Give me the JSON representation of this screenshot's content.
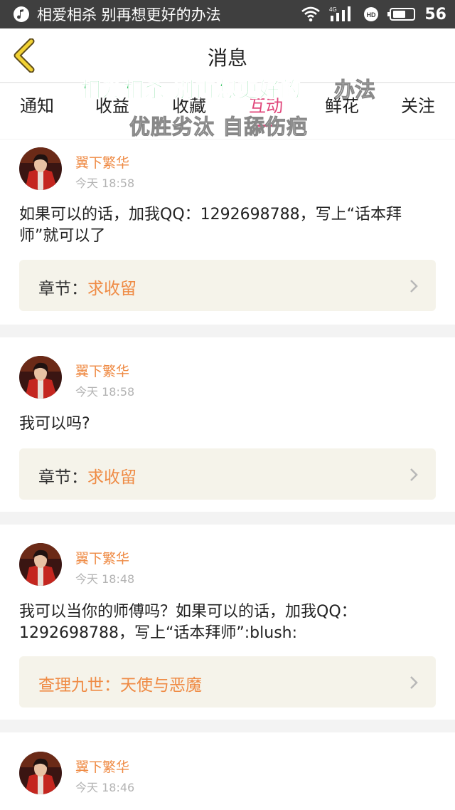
{
  "status_bar": {
    "app_icon": "music-note-icon",
    "title": "相爱相杀 别再想更好的办法",
    "time": "56",
    "icons": [
      "wifi-icon",
      "signal-4g-icon",
      "hd-icon",
      "battery-icon"
    ],
    "network_label": "4G",
    "hd_label": "HD"
  },
  "nav": {
    "back_icon": "back-arrow-icon",
    "title": "消息"
  },
  "tabs": [
    {
      "label": "通知",
      "active": false
    },
    {
      "label": "收益",
      "active": false
    },
    {
      "label": "收藏",
      "active": false
    },
    {
      "label": "互动",
      "active": true
    },
    {
      "label": "鲜花",
      "active": false
    },
    {
      "label": "关注",
      "active": false
    }
  ],
  "lyrics": {
    "line1_sung": "相爱相杀 别再想更好的",
    "line1_unsung": "办法",
    "line2": "优胜劣汰 自舔伤疤"
  },
  "messages": [
    {
      "username": "翼下繁华",
      "time": "今天 18:58",
      "content": "如果可以的话，加我QQ：1292698788，写上“话本拜师”就可以了",
      "chapter_label": "章节：",
      "chapter_value": "求收留"
    },
    {
      "username": "翼下繁华",
      "time": "今天 18:58",
      "content": "我可以吗?",
      "chapter_label": "章节：",
      "chapter_value": "求收留"
    },
    {
      "username": "翼下繁华",
      "time": "今天 18:48",
      "content": "我可以当你的师傅吗？如果可以的话，加我QQ：1292698788，写上“话本拜师”:blush:",
      "chapter_label": "查理九世：",
      "chapter_value": "天使与恶魔"
    },
    {
      "username": "翼下繁华",
      "time": "今天 18:46"
    }
  ],
  "colors": {
    "accent_orange": "#ef8b45",
    "active_tab_pink": "#e0457a",
    "lyric_green": "#28c15b"
  }
}
